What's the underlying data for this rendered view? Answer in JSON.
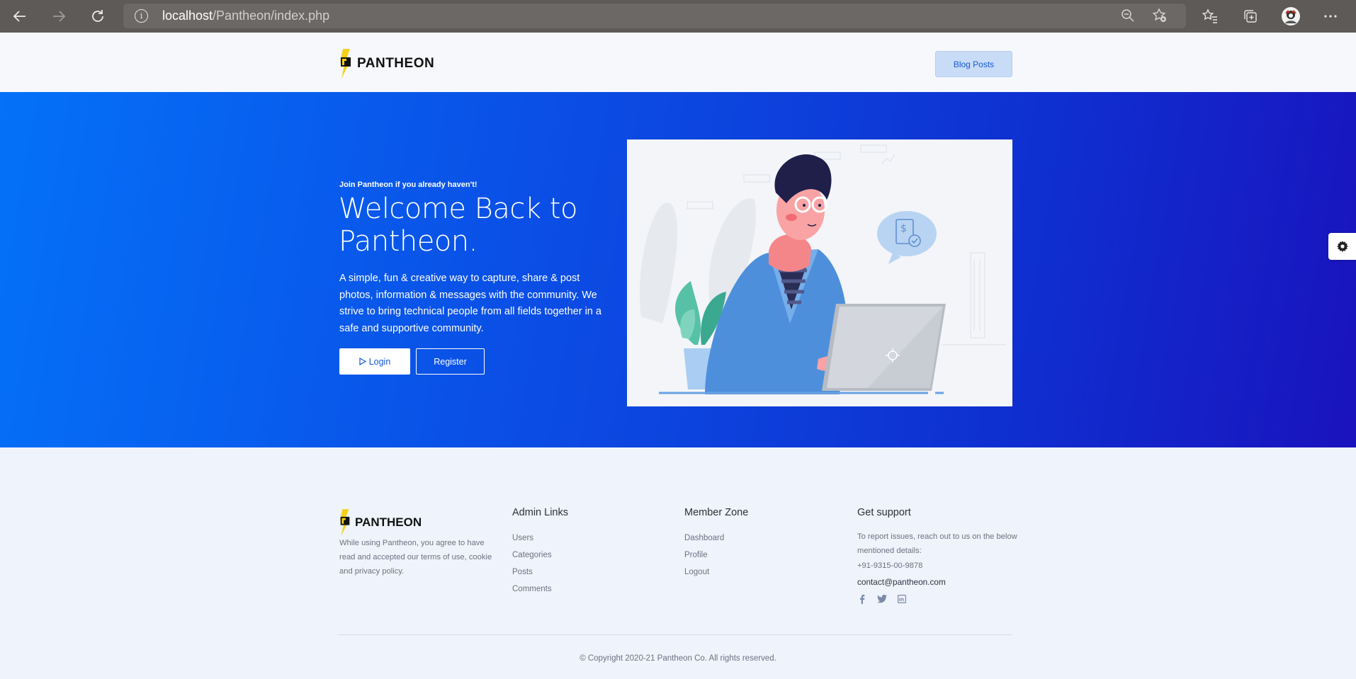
{
  "browser": {
    "url_host": "localhost",
    "url_path": "/Pantheon/index.php",
    "icons": [
      "back-icon",
      "forward-icon",
      "reload-icon",
      "site-info-icon",
      "zoom-out-icon",
      "add-favorite-icon",
      "favorites-icon",
      "collections-icon",
      "profile-avatar",
      "more-icon"
    ]
  },
  "header": {
    "brand": "PANTHEON",
    "blog_button": "Blog Posts"
  },
  "hero": {
    "kicker": "Join Pantheon if you already haven't!",
    "title": "Welcome Back to Pantheon.",
    "description": "A simple, fun & creative way to capture, share & post photos, information & messages with the community. We strive to bring technical people from all fields together in a safe and supportive community.",
    "login_label": "Login",
    "register_label": "Register"
  },
  "footer": {
    "brand": "PANTHEON",
    "about": "While using Pantheon, you agree to have read and accepted our terms of use, cookie and privacy policy.",
    "admin": {
      "heading": "Admin Links",
      "links": [
        "Users",
        "Categories",
        "Posts",
        "Comments"
      ]
    },
    "member": {
      "heading": "Member Zone",
      "links": [
        "Dashboard",
        "Profile",
        "Logout"
      ]
    },
    "support": {
      "heading": "Get support",
      "text": "To report issues, reach out to us on the below mentioned details:",
      "phone": "+91-9315-00-9878",
      "email": "contact@pantheon.com"
    },
    "socials": [
      "facebook-icon",
      "twitter-icon",
      "linkedin-icon"
    ],
    "copyright": "© Copyright 2020-21 Pantheon Co. All rights reserved."
  },
  "colors": {
    "hero_start": "#0471f8",
    "hero_end": "#1a13bd",
    "accent": "#1558d6",
    "footer_bg": "#eef3fc"
  }
}
